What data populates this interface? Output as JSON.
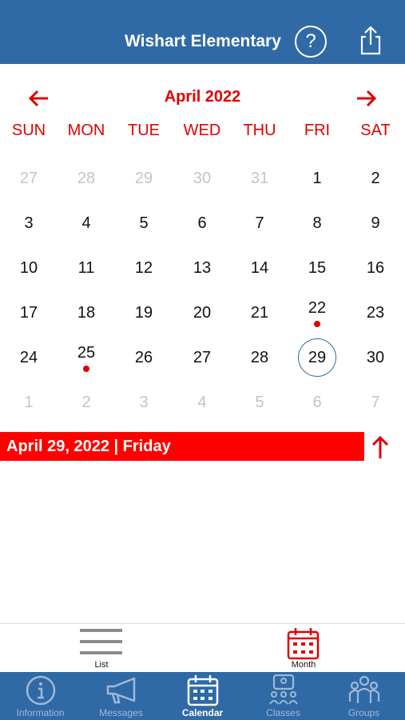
{
  "header": {
    "title": "Wishart Elementary",
    "help_glyph": "?",
    "help_icon": "question-circle-icon",
    "share_icon": "share-icon",
    "background": "#2f6aa6"
  },
  "calendar": {
    "month_label": "April 2022",
    "accent": "#e00000",
    "weekdays": [
      "SUN",
      "MON",
      "TUE",
      "WED",
      "THU",
      "FRI",
      "SAT"
    ],
    "weeks": [
      [
        {
          "d": "27",
          "m": true
        },
        {
          "d": "28",
          "m": true
        },
        {
          "d": "29",
          "m": true
        },
        {
          "d": "30",
          "m": true
        },
        {
          "d": "31",
          "m": true
        },
        {
          "d": "1"
        },
        {
          "d": "2"
        }
      ],
      [
        {
          "d": "3"
        },
        {
          "d": "4"
        },
        {
          "d": "5"
        },
        {
          "d": "6"
        },
        {
          "d": "7"
        },
        {
          "d": "8"
        },
        {
          "d": "9"
        }
      ],
      [
        {
          "d": "10"
        },
        {
          "d": "11"
        },
        {
          "d": "12"
        },
        {
          "d": "13"
        },
        {
          "d": "14"
        },
        {
          "d": "15"
        },
        {
          "d": "16"
        }
      ],
      [
        {
          "d": "17"
        },
        {
          "d": "18"
        },
        {
          "d": "19"
        },
        {
          "d": "20"
        },
        {
          "d": "21"
        },
        {
          "d": "22",
          "e": true
        },
        {
          "d": "23"
        }
      ],
      [
        {
          "d": "24"
        },
        {
          "d": "25",
          "e": true
        },
        {
          "d": "26"
        },
        {
          "d": "27"
        },
        {
          "d": "28"
        },
        {
          "d": "29",
          "t": true
        },
        {
          "d": "30"
        }
      ],
      [
        {
          "d": "1",
          "m": true
        },
        {
          "d": "2",
          "m": true
        },
        {
          "d": "3",
          "m": true
        },
        {
          "d": "4",
          "m": true
        },
        {
          "d": "5",
          "m": true
        },
        {
          "d": "6",
          "m": true
        },
        {
          "d": "7",
          "m": true
        }
      ]
    ]
  },
  "selected": {
    "text": "April 29, 2022 | Friday"
  },
  "view_switch": {
    "list_label": "List",
    "month_label": "Month"
  },
  "tabs": [
    {
      "label": "Information",
      "icon": "info-icon"
    },
    {
      "label": "Messages",
      "icon": "megaphone-icon"
    },
    {
      "label": "Calendar",
      "icon": "calendar-icon",
      "active": true
    },
    {
      "label": "Classes",
      "icon": "classes-icon"
    },
    {
      "label": "Groups",
      "icon": "groups-icon"
    }
  ]
}
